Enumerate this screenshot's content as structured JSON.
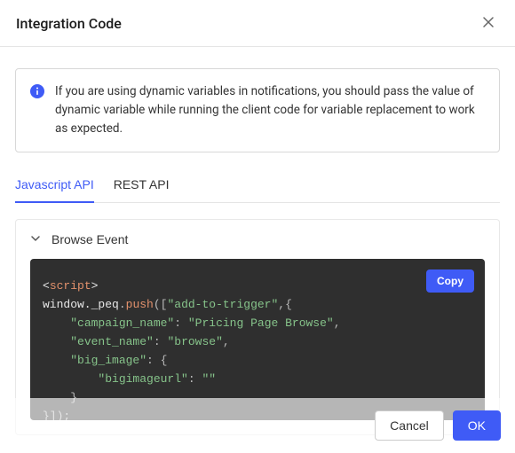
{
  "header": {
    "title": "Integration Code"
  },
  "info": {
    "text": "If you are using dynamic variables in notifications, you should pass the value of dynamic variable while running the client code for variable replacement to work as expected."
  },
  "tabs": [
    {
      "label": "Javascript API",
      "active": true
    },
    {
      "label": "REST API",
      "active": false
    }
  ],
  "accordion": {
    "title": "Browse Event"
  },
  "code": {
    "copy_label": "Copy",
    "script_tag": "script",
    "object": "window._peq",
    "method": "push",
    "trigger_arg": "\"add-to-trigger\"",
    "payload": {
      "campaign_name_key": "\"campaign_name\"",
      "campaign_name_val": "\"Pricing Page Browse\"",
      "event_name_key": "\"event_name\"",
      "event_name_val": "\"browse\"",
      "big_image_key": "\"big_image\"",
      "bigimageurl_key": "\"bigimageurl\"",
      "bigimageurl_val": "\"\""
    }
  },
  "actions": {
    "cancel": "Cancel",
    "ok": "OK"
  }
}
